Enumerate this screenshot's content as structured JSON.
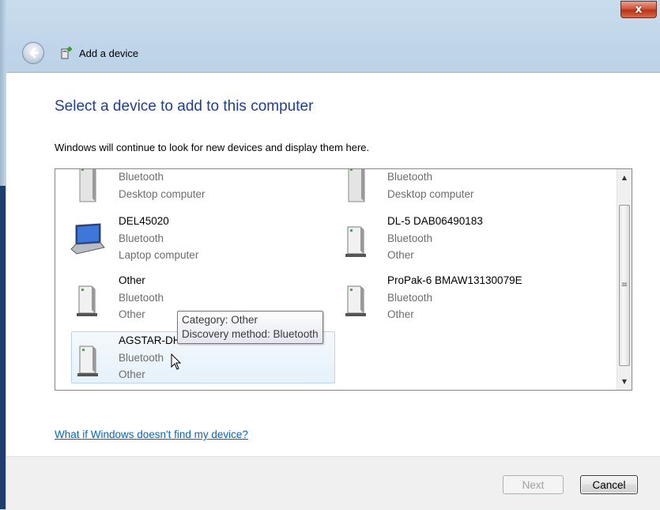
{
  "window": {
    "title": "Add a device",
    "close_label": "x"
  },
  "main": {
    "heading": "Select a device to add to this computer",
    "subtext": "Windows will continue to look for new devices and display them here."
  },
  "devices": [
    {
      "name": "",
      "line1": "Bluetooth",
      "line2": "Desktop computer",
      "icon": "desktop-tower-icon"
    },
    {
      "name": "",
      "line1": "Bluetooth",
      "line2": "Desktop computer",
      "icon": "desktop-tower-icon"
    },
    {
      "name": "DEL45020",
      "line1": "Bluetooth",
      "line2": "Laptop computer",
      "icon": "laptop-icon"
    },
    {
      "name": "DL-5 DAB06490183",
      "line1": "Bluetooth",
      "line2": "Other",
      "icon": "generic-device-icon"
    },
    {
      "name": "Other",
      "line1": "Bluetooth",
      "line2": "Other",
      "icon": "generic-device-icon"
    },
    {
      "name": "ProPak-6 BMAW13130079E",
      "line1": "Bluetooth",
      "line2": "Other",
      "icon": "generic-device-icon"
    },
    {
      "name": "AGSTAR-DHD13302209",
      "line1": "Bluetooth",
      "line2": "Other",
      "icon": "generic-device-icon",
      "selected": true
    }
  ],
  "tooltip": {
    "line1": "Category: Other",
    "line2": "Discovery method: Bluetooth"
  },
  "help_link": "What if Windows doesn't find my device?",
  "buttons": {
    "next": "Next",
    "cancel": "Cancel"
  },
  "colors": {
    "heading": "#1e3f8f",
    "link": "#0066cc",
    "close": "#c8432a"
  }
}
